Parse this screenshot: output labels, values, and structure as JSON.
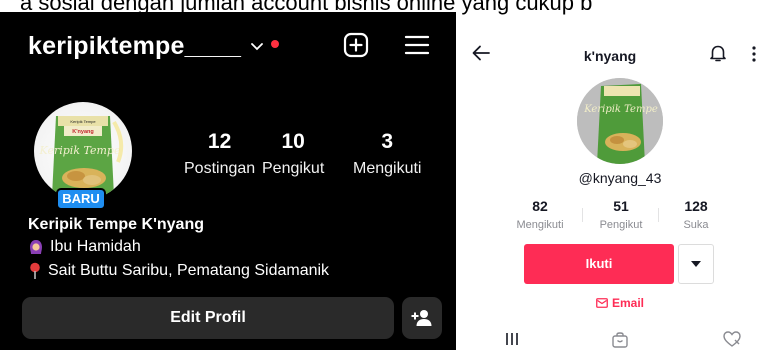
{
  "caption": "a sosial dengan jumlah account bisnis online yang cukup b",
  "instagram": {
    "username": "keripiktempe____",
    "avatar_badge": "BARU",
    "stats": [
      {
        "value": "12",
        "label": "Postingan"
      },
      {
        "value": "10",
        "label": "Pengikut"
      },
      {
        "value": "3",
        "label": "Mengikuti"
      }
    ],
    "bio_name": "Keripik Tempe K'nyang",
    "bio_person": "Ibu Hamidah",
    "bio_location": "Sait Buttu Saribu, Pematang Sidamanik",
    "edit_profile_label": "Edit Profil",
    "colors": {
      "background": "#000000",
      "badge": "#1f8ef1",
      "notification_dot": "#ff3040",
      "button": "#2a2a2a"
    }
  },
  "tiktok": {
    "title": "k'nyang",
    "handle": "@knyang_43",
    "stats": [
      {
        "value": "82",
        "label": "Mengikuti"
      },
      {
        "value": "51",
        "label": "Pengikut"
      },
      {
        "value": "128",
        "label": "Suka"
      }
    ],
    "follow_label": "Ikuti",
    "email_label": "Email",
    "colors": {
      "accent": "#fe2c55",
      "muted_text": "#8a8b91"
    }
  },
  "product_label": {
    "brand": "Keripik Tempe",
    "name": "K'nyang",
    "script": "Keripik Tempe"
  }
}
